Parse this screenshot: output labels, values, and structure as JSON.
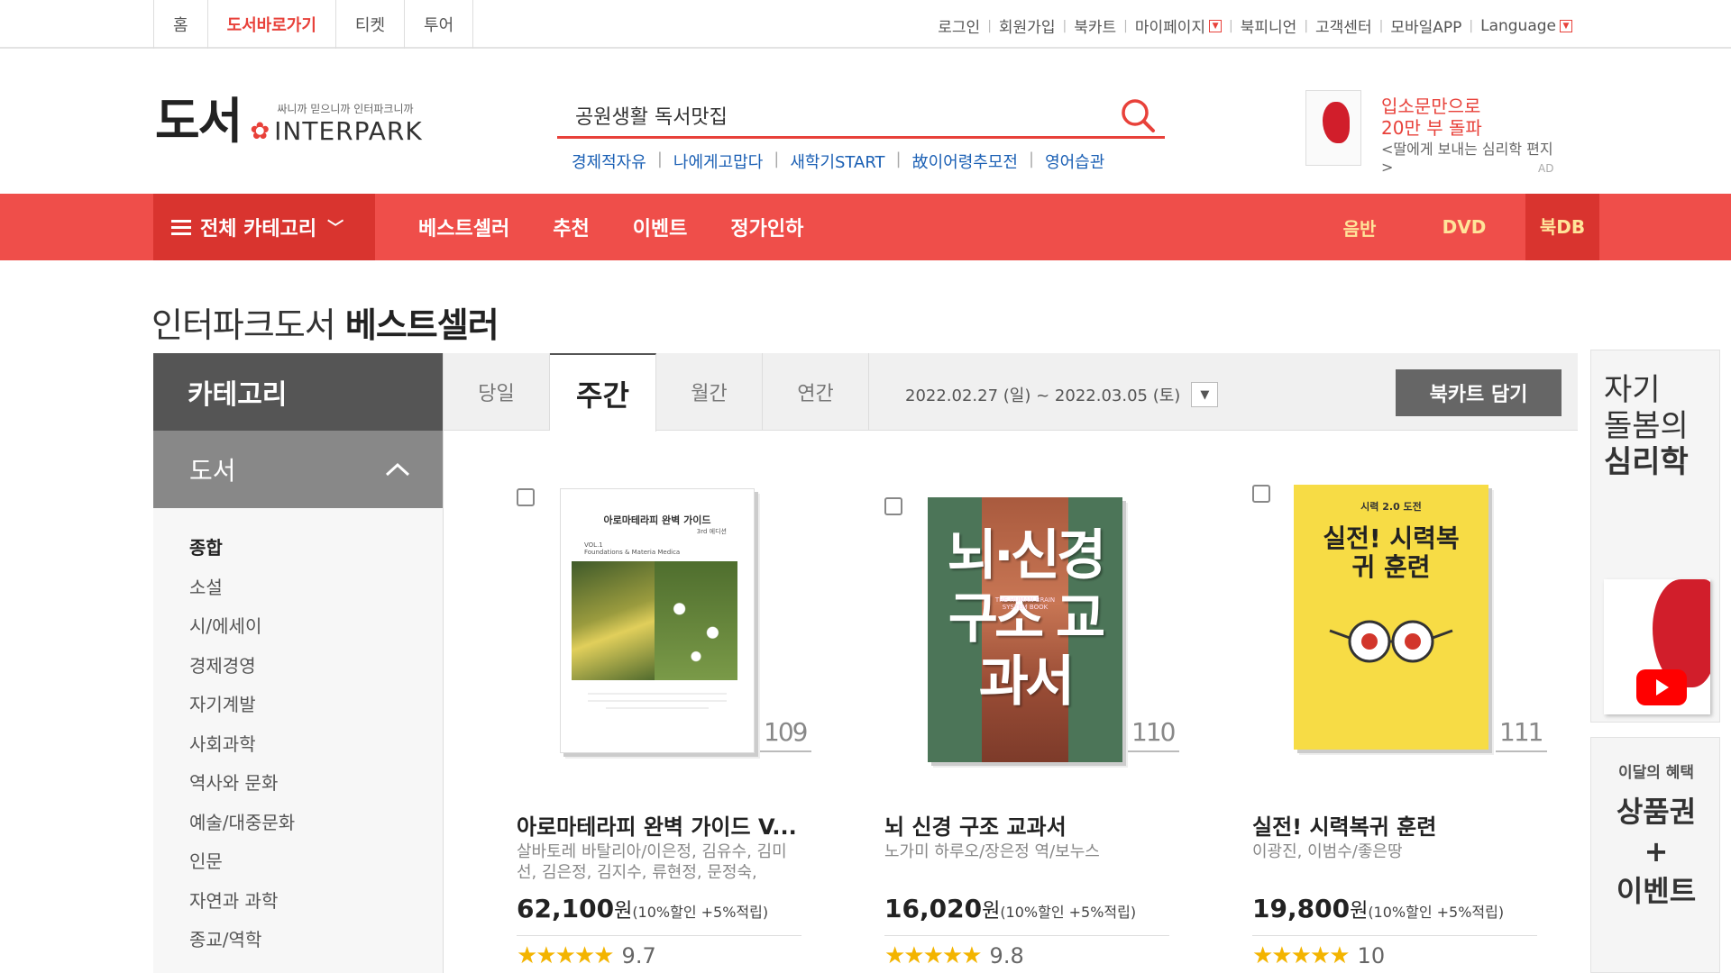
{
  "top_tabs": [
    "홈",
    "도서바로가기",
    "티켓",
    "투어"
  ],
  "util_links": [
    "로그인",
    "회원가입",
    "북카트",
    "마이페이지",
    "북피니언",
    "고객센터",
    "모바일APP",
    "Language"
  ],
  "logo": {
    "main": "도서",
    "slogan": "싸니까 믿으니까 인터파크니까",
    "brand": "INTERPARK"
  },
  "search": {
    "value": "공원생활 독서맛집"
  },
  "keywords": [
    "경제적자유",
    "나에게고맙다",
    "새학기START",
    "故이어령추모전",
    "영어습관"
  ],
  "top_ad": {
    "line1": "입소문만으로",
    "line2": "20만 부 돌파",
    "line3": "<딸에게 보내는 심리학 편지>",
    "label": "AD"
  },
  "nav": {
    "category": "전체 카테고리",
    "items": [
      "베스트셀러",
      "추천",
      "이벤트",
      "정가인하"
    ],
    "right_items": [
      "음반",
      "DVD",
      "북DB"
    ]
  },
  "page_title": {
    "prefix": "인터파크도서",
    "bold": "베스트셀러"
  },
  "sidebar": {
    "header": "카테고리",
    "section": "도서",
    "items": [
      "종합",
      "소설",
      "시/에세이",
      "경제경영",
      "자기계발",
      "사회과학",
      "역사와 문화",
      "예술/대중문화",
      "인문",
      "자연과 과학",
      "종교/역학"
    ]
  },
  "tabs": [
    "당일",
    "주간",
    "월간",
    "연간"
  ],
  "period": "2022.02.27 (일) ~ 2022.03.05 (토)",
  "cart_button": "북카트 담기",
  "products": [
    {
      "rank": "109",
      "title": "아로마테라피 완벽 가이드 V...",
      "author": "살바토레 바탈리아/이은정, 김유수, 김미선, 김은정, 김지수, 류현정, 문정숙,",
      "price": "62,100",
      "won": "원",
      "discount": "(10%할인 +5%적립)",
      "stars": "★★★★★",
      "score": "9.7",
      "cover_title": "아로마테라피 완벽 가이드",
      "cover_sub": "3rd 에디션",
      "cover_vol": "VOL.1",
      "cover_vol_sub": "Foundations & Materia Medica"
    },
    {
      "rank": "110",
      "title": "뇌 신경 구조 교과서",
      "author": "노가미 하루오/장은정 역/보누스",
      "price": "16,020",
      "won": "원",
      "discount": "(10%할인 +5%적립)",
      "stars": "★★★★★",
      "score": "9.8",
      "cover_title": "뇌·신경 구조 교과서",
      "cover_sub": "THE HUMAN BRAIN SYSTEM BOOK"
    },
    {
      "rank": "111",
      "title": "실전! 시력복귀 훈련",
      "author": "이광진, 이범수/좋은땅",
      "price": "19,800",
      "won": "원",
      "discount": "(10%할인 +5%적립)",
      "stars": "★★★★★",
      "score": "10",
      "cover_top": "시력 2.0 도전",
      "cover_title": "실전! 시력복귀 훈련"
    }
  ],
  "side_ad1": {
    "line1": "자기",
    "line2": "돌봄의",
    "line3": "심리학"
  },
  "side_ad2": {
    "line1": "이달의 혜택",
    "line2": "상품권",
    "line3": "+",
    "line4": "이벤트"
  },
  "colors": {
    "accent": "#ef4e4a",
    "accent_dark": "#d9342f",
    "link": "#1a5fb4",
    "star": "#f3b400"
  }
}
